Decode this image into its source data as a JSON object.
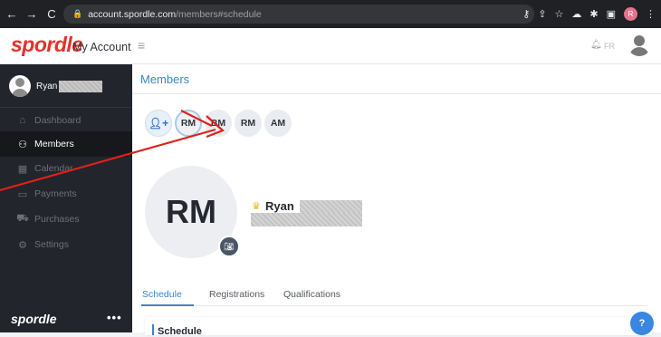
{
  "browser": {
    "url_host": "account.spordle.com",
    "url_path": "/members#schedule",
    "profile_initial": "R"
  },
  "header": {
    "logo": "spordle",
    "app_title": "My Account",
    "lang": "FR"
  },
  "sidebar": {
    "user_name": "Ryan",
    "items": [
      {
        "label": "Dashboard",
        "icon": "home-icon"
      },
      {
        "label": "Members",
        "icon": "user-icon",
        "active": true
      },
      {
        "label": "Calendar",
        "icon": "calendar-icon"
      },
      {
        "label": "Payments",
        "icon": "credit-card-icon"
      },
      {
        "label": "Purchases",
        "icon": "cart-icon"
      },
      {
        "label": "Settings",
        "icon": "gear-icon"
      }
    ],
    "footer_logo": "spordle",
    "more": "•••"
  },
  "main": {
    "title": "Members",
    "chips": [
      "RM",
      "BM",
      "RM",
      "AM"
    ],
    "selected_chip_index": 0,
    "avatar_initials": "RM",
    "member_name": "Ryan",
    "tabs": [
      "Schedule",
      "Registrations",
      "Qualifications"
    ],
    "active_tab": 0,
    "section_title": "Schedule",
    "help": "?"
  },
  "colors": {
    "brand_red": "#e4312b",
    "accent_blue": "#3a86c8",
    "annotation_red": "#e0201b"
  }
}
